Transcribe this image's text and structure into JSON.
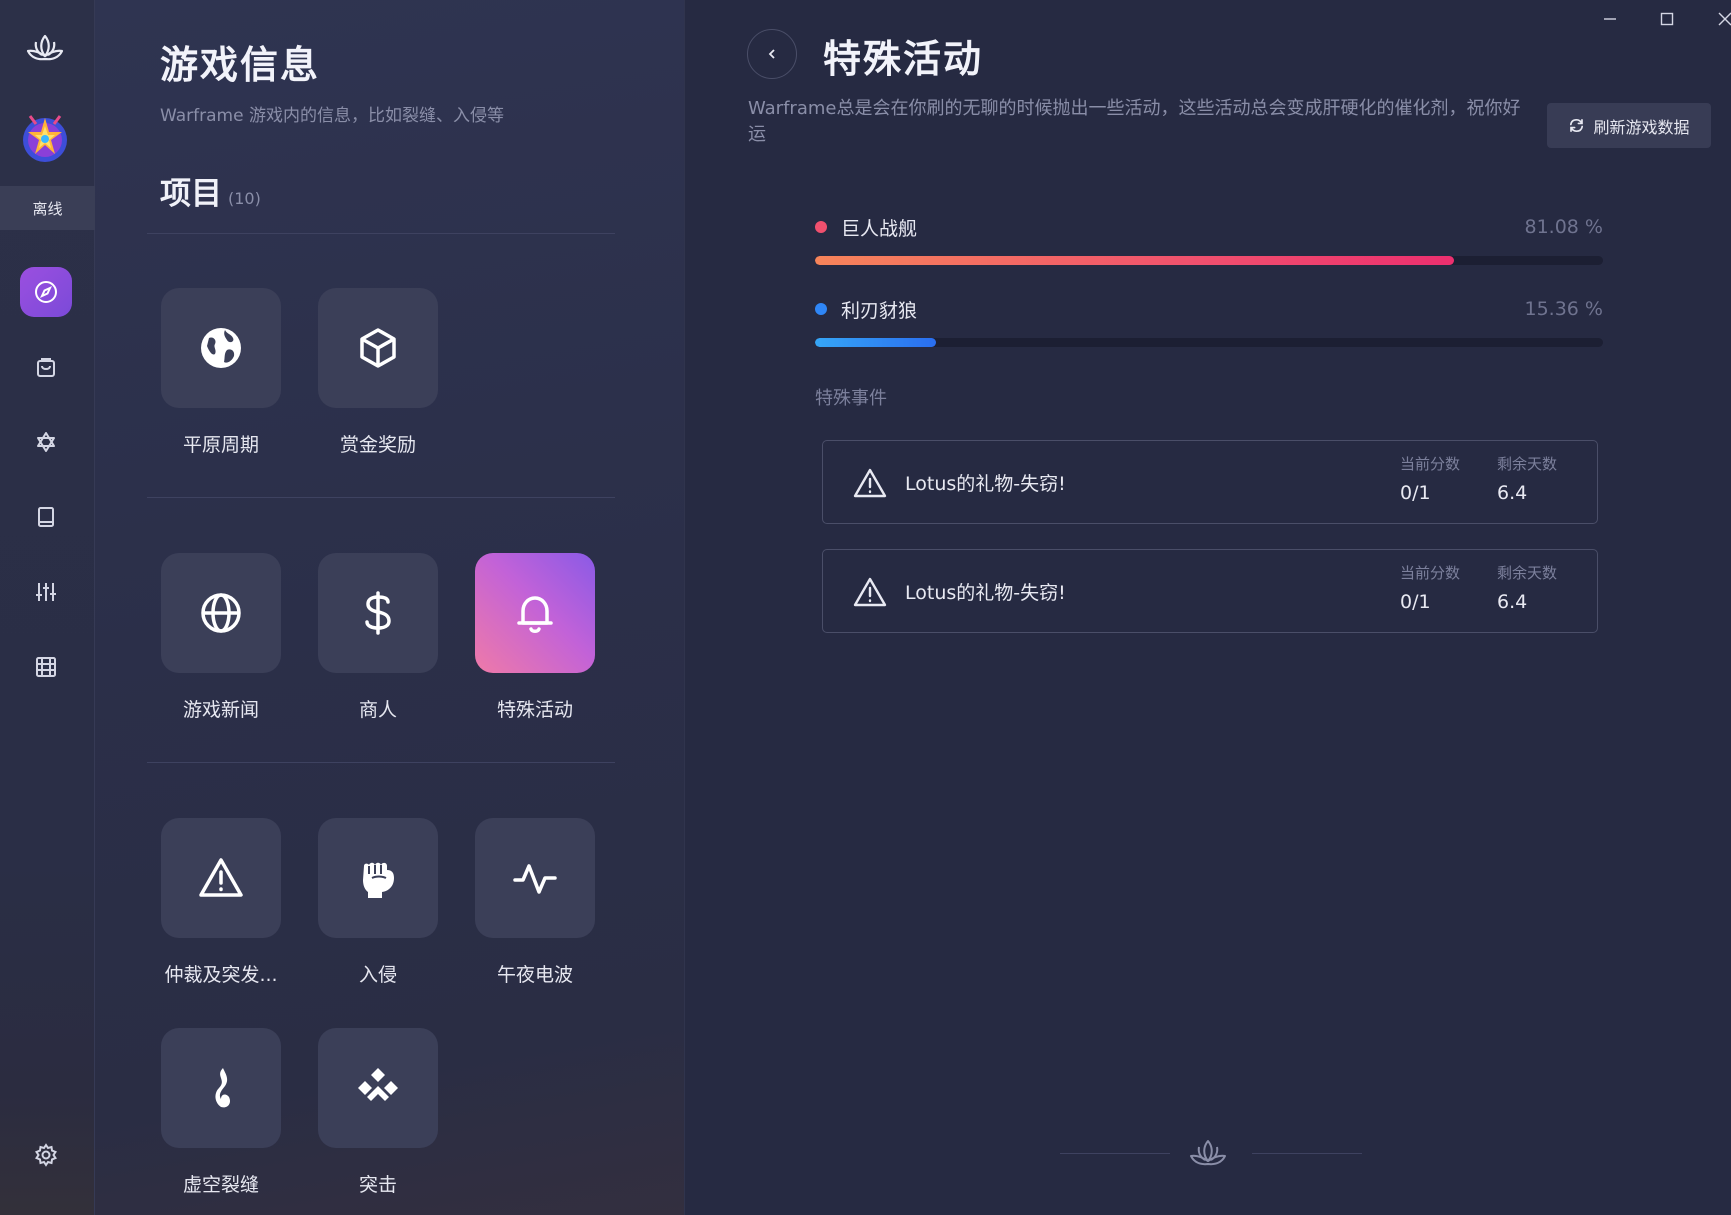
{
  "rail": {
    "status": "离线",
    "nav": [
      "explore-icon",
      "bag-icon",
      "star-of-david-icon",
      "book-icon",
      "sliders-icon",
      "film-icon"
    ],
    "settings": "gear-icon"
  },
  "info": {
    "title": "游戏信息",
    "subtitle": "Warframe 游戏内的信息，比如裂缝、入侵等",
    "section_title": "项目",
    "section_count": "(10)",
    "tiles": [
      {
        "label": "平原周期",
        "icon": "globe-icon"
      },
      {
        "label": "赏金奖励",
        "icon": "cube-icon"
      },
      {
        "label": "游戏新闻",
        "icon": "world-icon"
      },
      {
        "label": "商人",
        "icon": "dollar-icon"
      },
      {
        "label": "特殊活动",
        "icon": "bell-icon",
        "active": true
      },
      {
        "label": "仲裁及突发...",
        "icon": "warning-icon"
      },
      {
        "label": "入侵",
        "icon": "fist-icon"
      },
      {
        "label": "午夜电波",
        "icon": "pulse-icon"
      },
      {
        "label": "虚空裂缝",
        "icon": "flame-icon"
      },
      {
        "label": "突击",
        "icon": "assault-icon"
      }
    ]
  },
  "detail": {
    "title": "特殊活动",
    "description": "Warframe总是会在你刷的无聊的时候抛出一些活动，这些活动总会变成肝硬化的催化剂，祝你好运",
    "refresh_label": "刷新游戏数据",
    "progress": [
      {
        "name": "巨人战舰",
        "percent_text": "81.08 %",
        "value": 81.08,
        "color": "#f0506e"
      },
      {
        "name": "利刃豺狼",
        "percent_text": "15.36 %",
        "value": 15.36,
        "color": "#2f86f6"
      }
    ],
    "events_label": "特殊事件",
    "events": [
      {
        "name": "Lotus的礼物-失窃!",
        "score_label": "当前分数",
        "score": "0/1",
        "days_label": "剩余天数",
        "days": "6.4"
      },
      {
        "name": "Lotus的礼物-失窃!",
        "score_label": "当前分数",
        "score": "0/1",
        "days_label": "剩余天数",
        "days": "6.4"
      }
    ]
  }
}
